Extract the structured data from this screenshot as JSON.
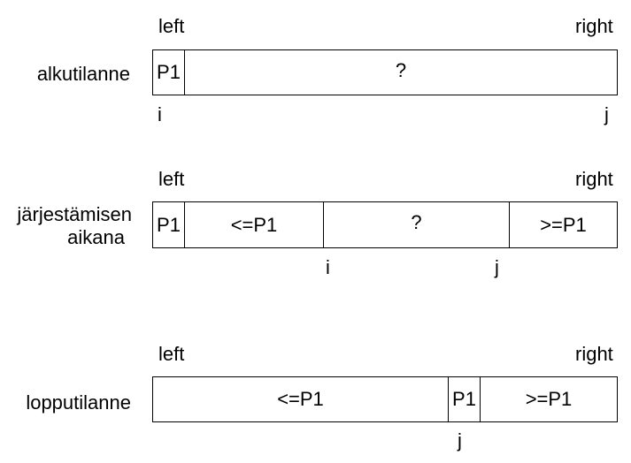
{
  "rows": [
    {
      "label": "alkutilanne",
      "left": "left",
      "right": "right",
      "cells": [
        "P1",
        "?"
      ],
      "pointers": [
        "i",
        "j"
      ]
    },
    {
      "label_line1": "järjestämisen",
      "label_line2": "aikana",
      "left": "left",
      "right": "right",
      "cells": [
        "P1",
        "<=P1",
        "?",
        ">=P1"
      ],
      "pointers": [
        "i",
        "j"
      ]
    },
    {
      "label": "lopputilanne",
      "left": "left",
      "right": "right",
      "cells": [
        "<=P1",
        "P1",
        ">=P1"
      ],
      "pointers": [
        "j"
      ]
    }
  ]
}
